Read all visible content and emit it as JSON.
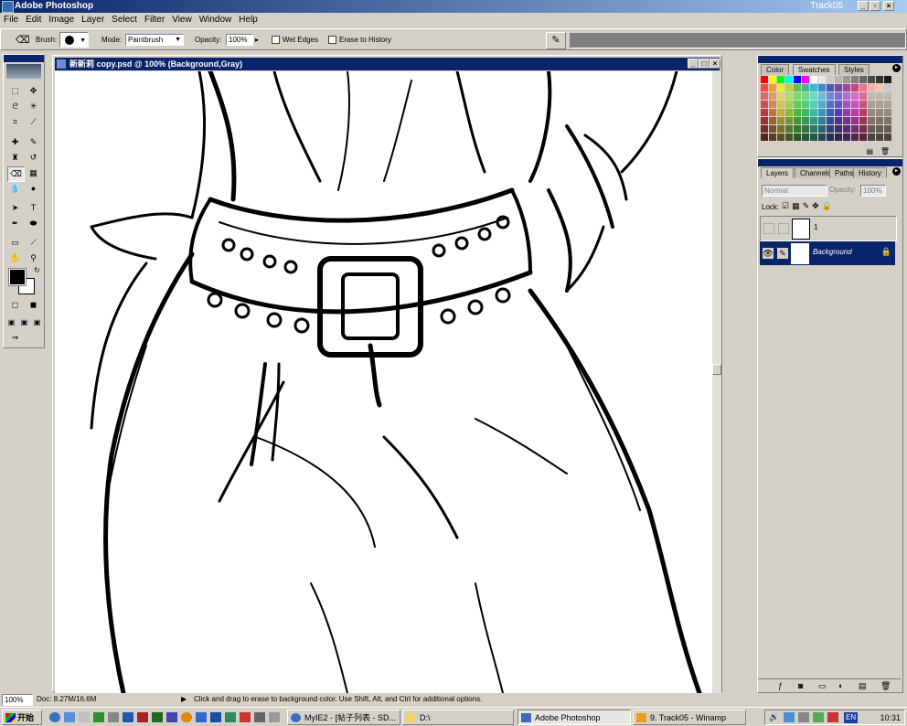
{
  "app": {
    "title": "Adobe Photoshop",
    "active_doc": "Track05"
  },
  "menu": [
    "File",
    "Edit",
    "Image",
    "Layer",
    "Select",
    "Filter",
    "View",
    "Window",
    "Help"
  ],
  "options": {
    "brush_label": "Brush:",
    "mode_label": "Mode:",
    "mode_value": "Paintbrush",
    "opacity_label": "Opacity:",
    "opacity_value": "100%",
    "wet_edges": "Wet Edges",
    "erase_history": "Erase to History"
  },
  "document": {
    "title": "新新莉 copy.psd @ 100% (Background,Gray)"
  },
  "swatch_tabs": [
    "Color",
    "Swatches",
    "Styles"
  ],
  "swatch_colors": [
    "#ff0000",
    "#ffff00",
    "#00ff00",
    "#00ffff",
    "#0000ff",
    "#ff00ff",
    "#ffffff",
    "#e6e6e6",
    "#cccccc",
    "#b3b3b3",
    "#999999",
    "#808080",
    "#666666",
    "#4d4d4d",
    "#333333",
    "#1a1a1a",
    "#f24b3d",
    "#f59a3c",
    "#fbe33c",
    "#b5d53e",
    "#5fc14a",
    "#3fb98f",
    "#3db6d1",
    "#3f8ad0",
    "#4a5bb6",
    "#7549ab",
    "#a6419c",
    "#d1427b",
    "#e37a88",
    "#f2b1b4",
    "#f6c8a8",
    "#c9c9c9"
  ],
  "layer_tabs": [
    "Layers",
    "Channels",
    "Paths",
    "History"
  ],
  "layers": {
    "blend_mode": "Normal",
    "opacity_label": "Opacity:",
    "opacity_value": "100%",
    "lock_label": "Lock:",
    "items": [
      {
        "name": "1",
        "selected": false
      },
      {
        "name": "Background",
        "selected": true
      }
    ]
  },
  "status": {
    "zoom": "100%",
    "doc_size": "Doc: 8.27M/16.6M",
    "hint": "Click and drag to erase to background color.  Use Shift, Alt, and Ctrl for additional options."
  },
  "taskbar": {
    "start": "开始",
    "tasks": [
      "MyIE2 - [帖子列表 - SD...",
      "D:\\",
      "Adobe Photoshop",
      "9. Track05 - Winamp"
    ],
    "clock": "10:31",
    "lang": "EN"
  }
}
